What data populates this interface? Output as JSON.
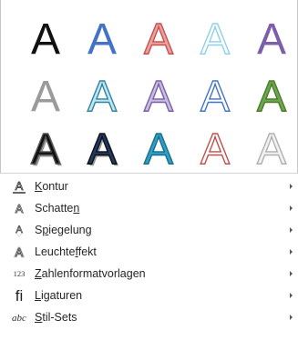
{
  "gallery": {
    "letter": "A",
    "rows": [
      [
        {
          "name": "black-solid",
          "fill": "#111111",
          "stroke": "none"
        },
        {
          "name": "blue-solid",
          "fill": "#4472c4",
          "stroke": "none"
        },
        {
          "name": "pink-outline",
          "fill": "#e8a3a1",
          "stroke": "#c9504c"
        },
        {
          "name": "light-teal-outline",
          "fill": "#ffffff",
          "stroke": "#8fd1e8"
        },
        {
          "name": "purple-solid",
          "fill": "#7b5fa8",
          "stroke": "none"
        }
      ],
      [
        {
          "name": "gray-solid",
          "fill": "#9a9a9a",
          "stroke": "none"
        },
        {
          "name": "teal-gradient",
          "fill": "#bfe5f5",
          "stroke": "#31859c"
        },
        {
          "name": "lavender-outline",
          "fill": "#c8bde0",
          "stroke": "#7b5fa8"
        },
        {
          "name": "white-blue-outline",
          "fill": "#ffffff",
          "stroke": "#4472c4"
        },
        {
          "name": "green-solid",
          "fill": "#6aa84f",
          "stroke": "#4f7a2a"
        }
      ],
      [
        {
          "name": "black-shadow",
          "fill": "#111111",
          "stroke": "#555555"
        },
        {
          "name": "dark-blue-shadow",
          "fill": "#1f3864",
          "stroke": "#111111"
        },
        {
          "name": "cyan-gradient",
          "fill": "#2e9fc7",
          "stroke": "#1b6e8a"
        },
        {
          "name": "red-outline",
          "fill": "#ffffff",
          "stroke": "#c0504d"
        },
        {
          "name": "silver-soft",
          "fill": "#f2f2f2",
          "stroke": "#b0b0b0"
        }
      ]
    ]
  },
  "menu": {
    "items": [
      {
        "id": "kontur",
        "icon": "outline-a-icon",
        "glyph": "A",
        "pre": "",
        "u": "K",
        "post": "ontur"
      },
      {
        "id": "schatten",
        "icon": "shadow-a-icon",
        "glyph": "A",
        "pre": "Schatte",
        "u": "n",
        "post": ""
      },
      {
        "id": "spiegelung",
        "icon": "reflection-a-icon",
        "glyph": "A",
        "pre": "S",
        "u": "p",
        "post": "iegelung"
      },
      {
        "id": "leuchteffekt",
        "icon": "glow-a-icon",
        "glyph": "A",
        "pre": "Leuchte",
        "u": "f",
        "post": "fekt"
      },
      {
        "id": "zahlenformatvorlagen",
        "icon": "number-123-icon",
        "glyph": "123",
        "pre": "",
        "u": "Z",
        "post": "ahlenformatvorlagen"
      },
      {
        "id": "ligaturen",
        "icon": "ligature-fi-icon",
        "glyph": "fi",
        "pre": "",
        "u": "L",
        "post": "igaturen"
      },
      {
        "id": "stil-sets",
        "icon": "stylistic-abc-icon",
        "glyph": "abc",
        "pre": "",
        "u": "S",
        "post": "til-Sets"
      }
    ]
  }
}
